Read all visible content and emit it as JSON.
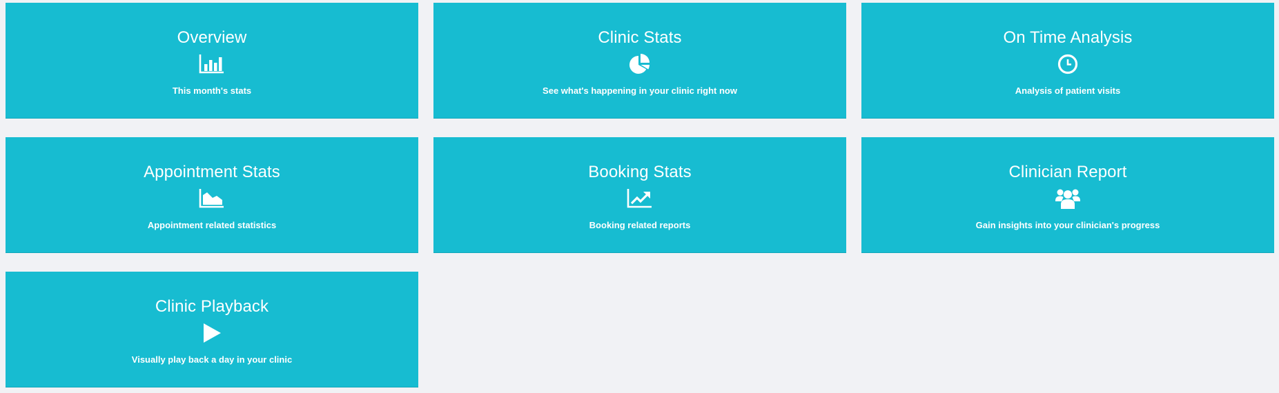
{
  "colors": {
    "page_background": "#f1f2f5",
    "card_background": "#17bcd1",
    "card_text": "#ffffff"
  },
  "cards": [
    {
      "title": "Overview",
      "description": "This month's stats",
      "icon": "bar-chart-icon"
    },
    {
      "title": "Clinic Stats",
      "description": "See what's happening in your clinic right now",
      "icon": "pie-chart-icon"
    },
    {
      "title": "On Time Analysis",
      "description": "Analysis of patient visits",
      "icon": "clock-icon"
    },
    {
      "title": "Appointment Stats",
      "description": "Appointment related statistics",
      "icon": "area-chart-icon"
    },
    {
      "title": "Booking Stats",
      "description": "Booking related reports",
      "icon": "line-chart-trending-up-icon"
    },
    {
      "title": "Clinician Report",
      "description": "Gain insights into your clinician's progress",
      "icon": "users-group-icon"
    },
    {
      "title": "Clinic Playback",
      "description": "Visually play back a day in your clinic",
      "icon": "play-icon"
    }
  ]
}
